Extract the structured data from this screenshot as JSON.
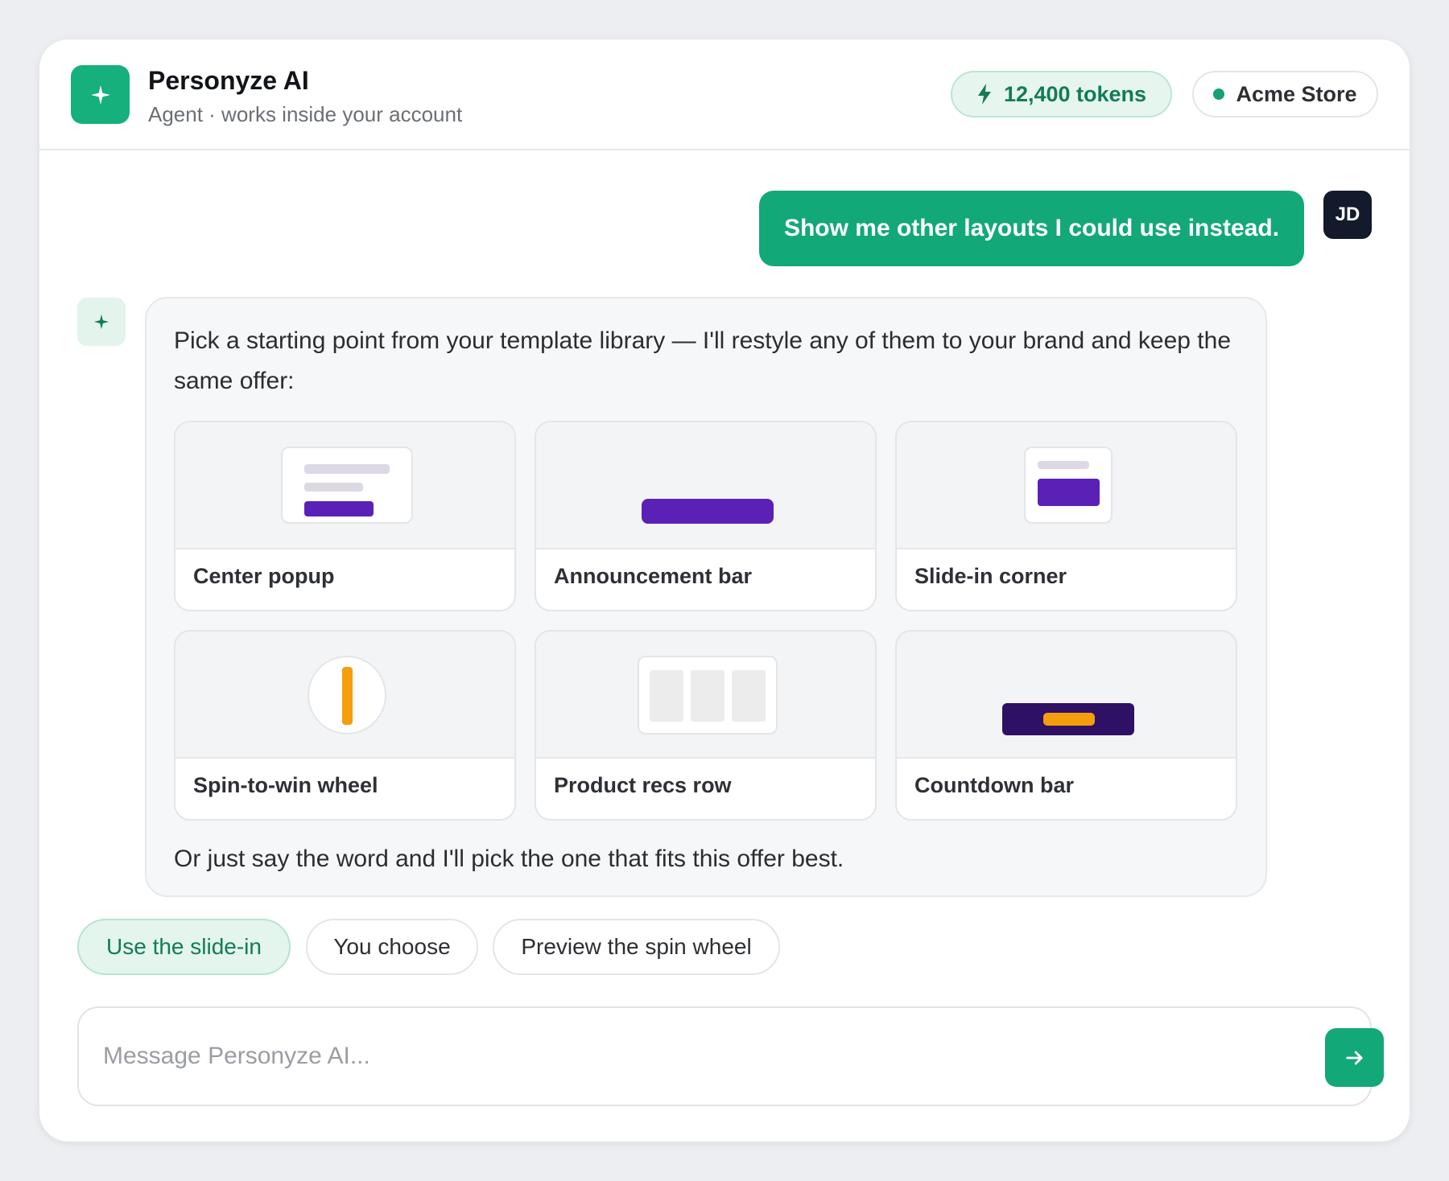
{
  "header": {
    "app_name": "Personyze AI",
    "subtitle": "Agent · works inside your account",
    "tokens_label": "12,400 tokens",
    "store_name": "Acme Store"
  },
  "colors": {
    "brand_green": "#16b07d",
    "user_bubble": "#13a878",
    "accent_purple": "#5b21b6",
    "accent_orange": "#f59e0b",
    "dark_navy": "#121a2c"
  },
  "conversation": {
    "user_message": "Show me other layouts I could use instead.",
    "user_initials": "JD",
    "ai_intro": "Pick a starting point from your template library — I'll restyle any of them to your brand and keep the same offer:",
    "ai_outro": "Or just say the word and I'll pick the one that fits this offer best.",
    "templates": [
      {
        "label": "Center popup",
        "icon": "center-popup-preview"
      },
      {
        "label": "Announcement bar",
        "icon": "announcement-bar-preview"
      },
      {
        "label": "Slide-in corner",
        "icon": "slide-in-corner-preview"
      },
      {
        "label": "Spin-to-win wheel",
        "icon": "spin-wheel-preview"
      },
      {
        "label": "Product recs row",
        "icon": "product-recs-preview"
      },
      {
        "label": "Countdown bar",
        "icon": "countdown-bar-preview"
      }
    ]
  },
  "quick_replies": [
    "Use the slide-in",
    "You choose",
    "Preview the spin wheel"
  ],
  "composer": {
    "placeholder": "Message Personyze AI...",
    "send_icon": "arrow-right-icon"
  }
}
